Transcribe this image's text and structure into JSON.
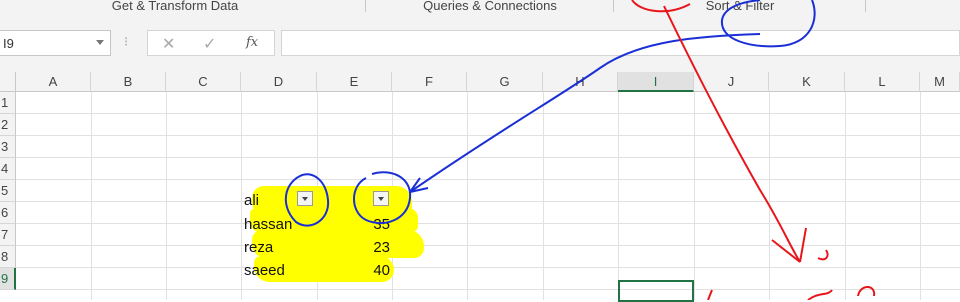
{
  "ribbon": {
    "groups": [
      "Get & Transform Data",
      "Queries & Connections",
      "Sort & Filter"
    ]
  },
  "formula_bar": {
    "name_box": "I9",
    "fx_label": "fx",
    "formula_value": ""
  },
  "columns": [
    "A",
    "B",
    "C",
    "D",
    "E",
    "F",
    "G",
    "H",
    "I",
    "J",
    "K",
    "L",
    "M"
  ],
  "rows": [
    "1",
    "2",
    "3",
    "4",
    "5",
    "6",
    "7",
    "8",
    "9"
  ],
  "active_cell": "I9",
  "cells": {
    "d5": "ali",
    "d6": "hassan",
    "e6": "35",
    "d7": "reza",
    "e7": "23",
    "d8": "saeed",
    "e8": "40"
  },
  "annotations": {
    "blue_color": "#1a2fd6",
    "red_color": "#e8151b",
    "highlight_color": "#ffff00"
  }
}
